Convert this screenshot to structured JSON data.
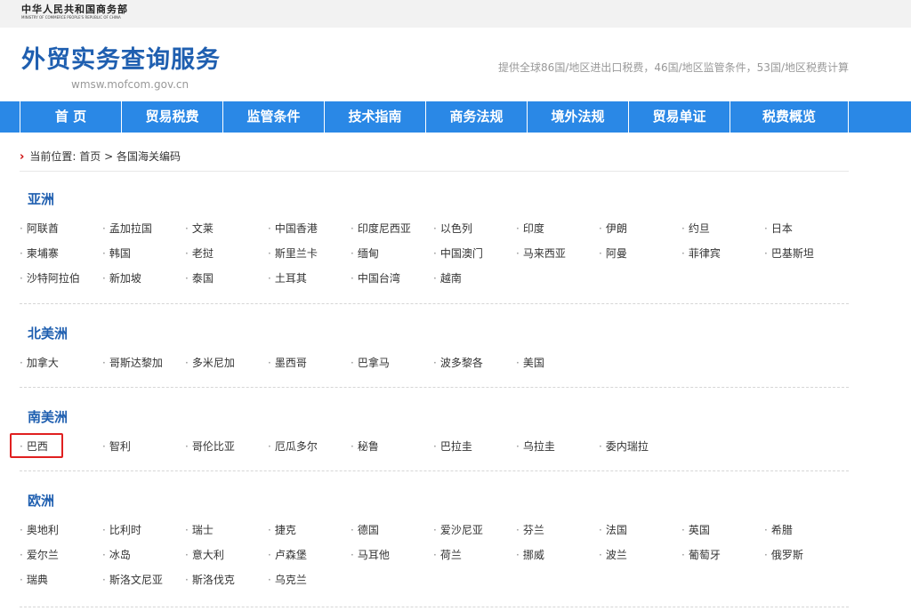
{
  "ministry": {
    "name_cn": "中华人民共和国商务部",
    "name_en": "MINISTRY OF COMMERCE PEOPLE'S REPUBLIC OF CHINA"
  },
  "brand": {
    "title": "外贸实务查询服务",
    "domain": "wmsw.mofcom.gov.cn",
    "slogan": "提供全球86国/地区进出口税费，46国/地区监管条件，53国/地区税费计算"
  },
  "nav": [
    "首 页",
    "贸易税费",
    "监管条件",
    "技术指南",
    "商务法规",
    "境外法规",
    "贸易单证",
    "税费概览"
  ],
  "breadcrumb": {
    "prefix": "当前位置:",
    "home": "首页",
    "separator": ">",
    "current": "各国海关编码"
  },
  "sections": [
    {
      "title": "亚洲",
      "countries": [
        "阿联酋",
        "孟加拉国",
        "文莱",
        "中国香港",
        "印度尼西亚",
        "以色列",
        "印度",
        "伊朗",
        "约旦",
        "日本",
        "柬埔寨",
        "韩国",
        "老挝",
        "斯里兰卡",
        "缅甸",
        "中国澳门",
        "马来西亚",
        "阿曼",
        "菲律宾",
        "巴基斯坦",
        "沙特阿拉伯",
        "新加坡",
        "泰国",
        "土耳其",
        "中国台湾",
        "越南"
      ]
    },
    {
      "title": "北美洲",
      "countries": [
        "加拿大",
        "哥斯达黎加",
        "多米尼加",
        "墨西哥",
        "巴拿马",
        "波多黎各",
        "美国"
      ]
    },
    {
      "title": "南美洲",
      "countries": [
        "巴西",
        "智利",
        "哥伦比亚",
        "厄瓜多尔",
        "秘鲁",
        "巴拉圭",
        "乌拉圭",
        "委内瑞拉"
      ]
    },
    {
      "title": "欧洲",
      "countries": [
        "奥地利",
        "比利时",
        "瑞士",
        "捷克",
        "德国",
        "爱沙尼亚",
        "芬兰",
        "法国",
        "英国",
        "希腊",
        "爱尔兰",
        "冰岛",
        "意大利",
        "卢森堡",
        "马耳他",
        "荷兰",
        "挪威",
        "波兰",
        "葡萄牙",
        "俄罗斯",
        "瑞典",
        "斯洛文尼亚",
        "斯洛伐克",
        "乌克兰"
      ]
    }
  ],
  "highlight": {
    "color": "#e02020"
  },
  "colors": {
    "nav_bg": "#2a88e6",
    "title_blue": "#1f5fb0",
    "breadcrumb_arrow": "#cc0000"
  }
}
